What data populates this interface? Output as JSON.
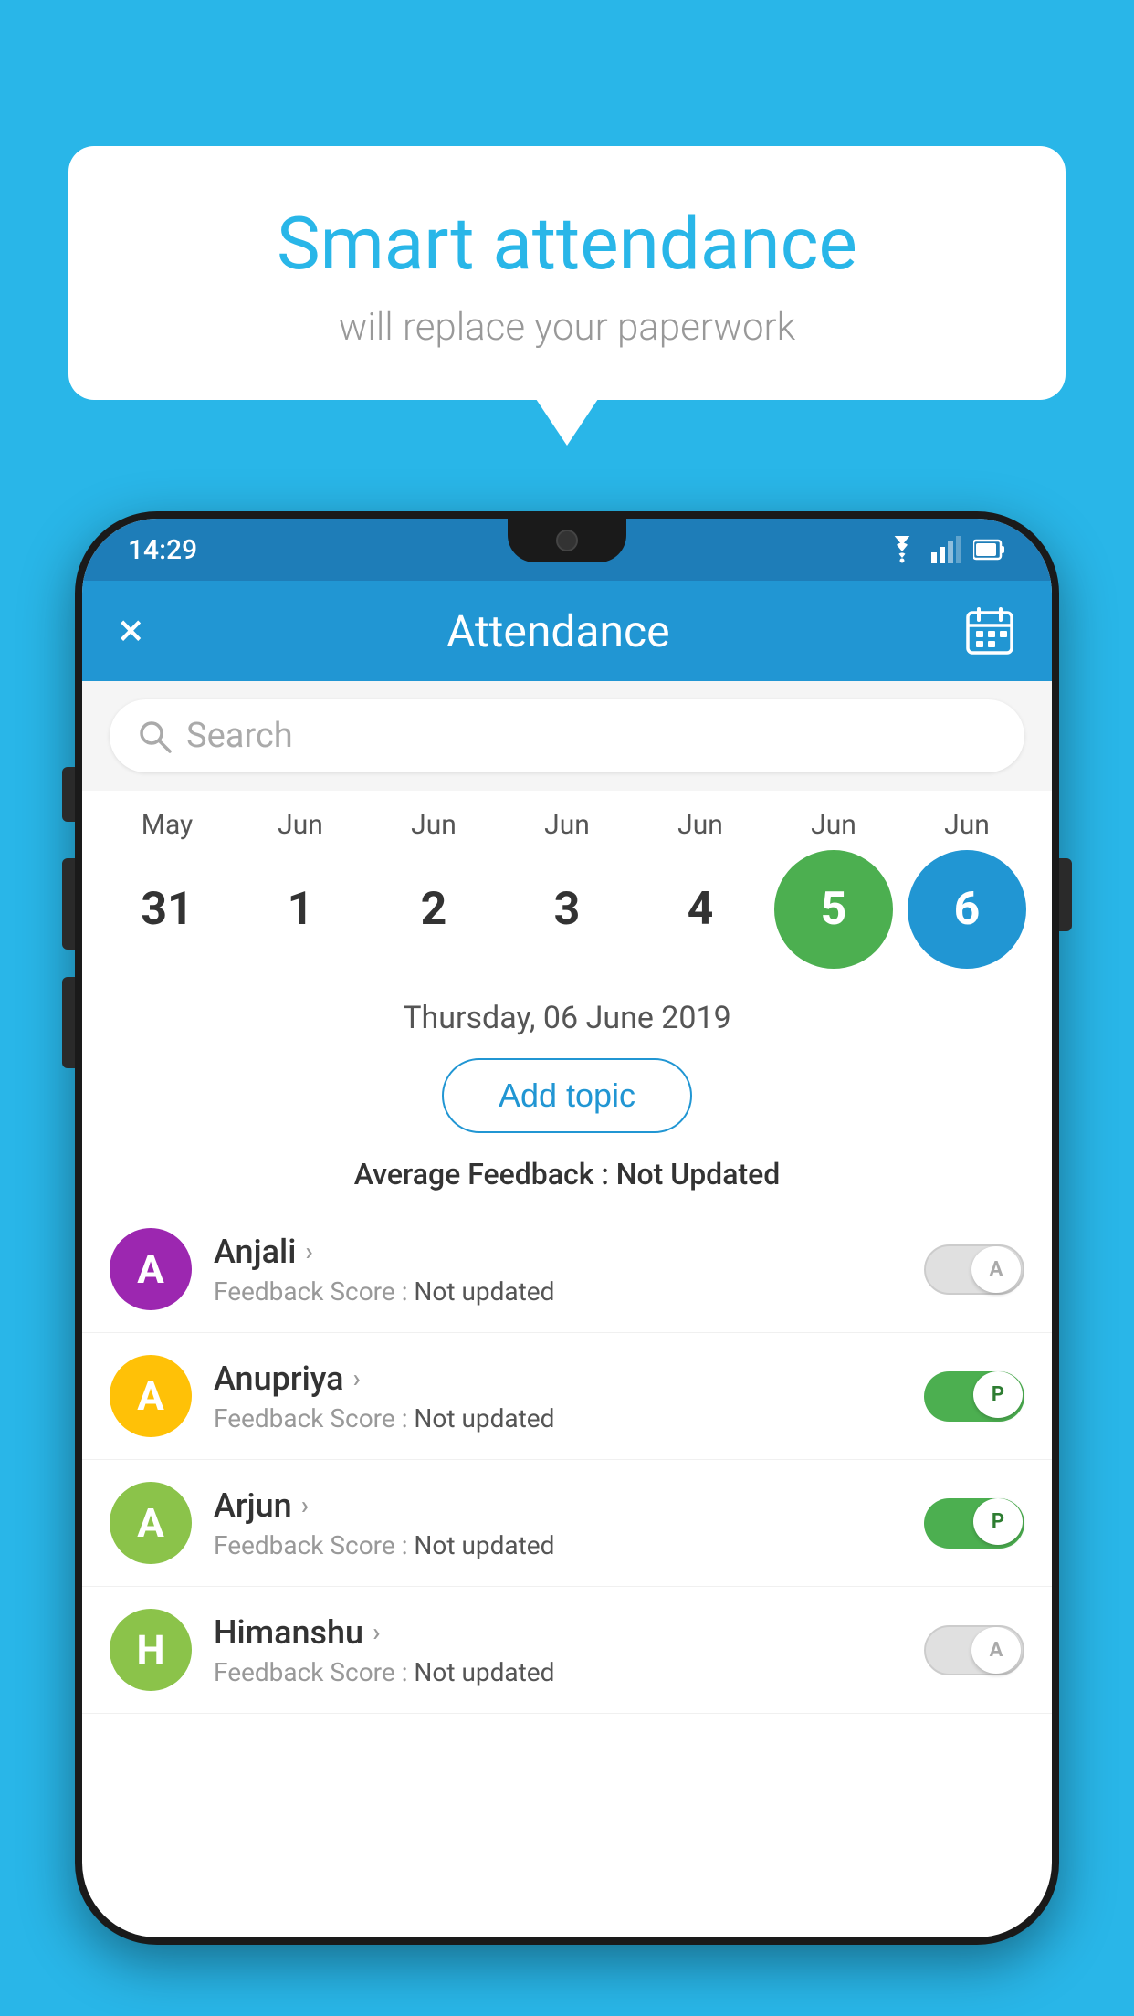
{
  "background_color": "#29b6e8",
  "speech_bubble": {
    "title": "Smart attendance",
    "subtitle": "will replace your paperwork"
  },
  "status_bar": {
    "time": "14:29",
    "icons": [
      "wifi",
      "signal",
      "battery"
    ]
  },
  "app_bar": {
    "close_label": "×",
    "title": "Attendance",
    "calendar_label": "calendar"
  },
  "search": {
    "placeholder": "Search"
  },
  "calendar": {
    "months": [
      "May",
      "Jun",
      "Jun",
      "Jun",
      "Jun",
      "Jun",
      "Jun"
    ],
    "days": [
      "31",
      "1",
      "2",
      "3",
      "4",
      "5",
      "6"
    ],
    "active_green_index": 5,
    "active_blue_index": 6
  },
  "selected_date": "Thursday, 06 June 2019",
  "add_topic_label": "Add topic",
  "average_feedback_label": "Average Feedback : ",
  "average_feedback_value": "Not Updated",
  "students": [
    {
      "name": "Anjali",
      "avatar_letter": "A",
      "avatar_color": "#9c27b0",
      "feedback_label": "Feedback Score : ",
      "feedback_value": "Not updated",
      "toggle_state": "off",
      "toggle_letter": "A"
    },
    {
      "name": "Anupriya",
      "avatar_letter": "A",
      "avatar_color": "#ffc107",
      "feedback_label": "Feedback Score : ",
      "feedback_value": "Not updated",
      "toggle_state": "on",
      "toggle_letter": "P"
    },
    {
      "name": "Arjun",
      "avatar_letter": "A",
      "avatar_color": "#8bc34a",
      "feedback_label": "Feedback Score : ",
      "feedback_value": "Not updated",
      "toggle_state": "on",
      "toggle_letter": "P"
    },
    {
      "name": "Himanshu",
      "avatar_letter": "H",
      "avatar_color": "#8bc34a",
      "feedback_label": "Feedback Score : ",
      "feedback_value": "Not updated",
      "toggle_state": "off",
      "toggle_letter": "A"
    }
  ]
}
